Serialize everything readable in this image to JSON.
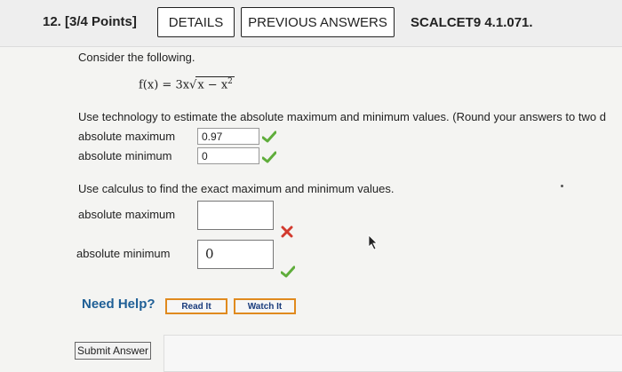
{
  "header": {
    "question_number": "12.",
    "points": "[3/4 Points]",
    "details_label": "DETAILS",
    "previous_answers_label": "PREVIOUS ANSWERS",
    "course_code": "SCALCET9 4.1.071."
  },
  "problem": {
    "intro": "Consider the following.",
    "function_lhs": "f(x) = 3x",
    "function_radicand": "x − x",
    "function_exponent": "2",
    "part1_instruction": "Use technology to estimate the absolute maximum and minimum values. (Round your answers to two d",
    "part1": {
      "max_label": "absolute maximum",
      "max_value": "0.97",
      "max_status": "correct",
      "min_label": "absolute minimum",
      "min_value": "0",
      "min_status": "correct"
    },
    "part2_instruction": "Use calculus to find the exact maximum and minimum values.",
    "part2": {
      "max_label": "absolute maximum",
      "max_value": "",
      "max_status": "incorrect",
      "min_label": "absolute minimum",
      "min_value": "0",
      "min_status": "correct"
    }
  },
  "help": {
    "need_help": "Need Help?",
    "read_it": "Read It",
    "watch_it": "Watch It"
  },
  "submit_label": "Submit Answer",
  "colors": {
    "correct": "#5fad3b",
    "incorrect": "#d23a2e",
    "help_text": "#1f5f96",
    "help_button_border": "#e08a1e"
  }
}
